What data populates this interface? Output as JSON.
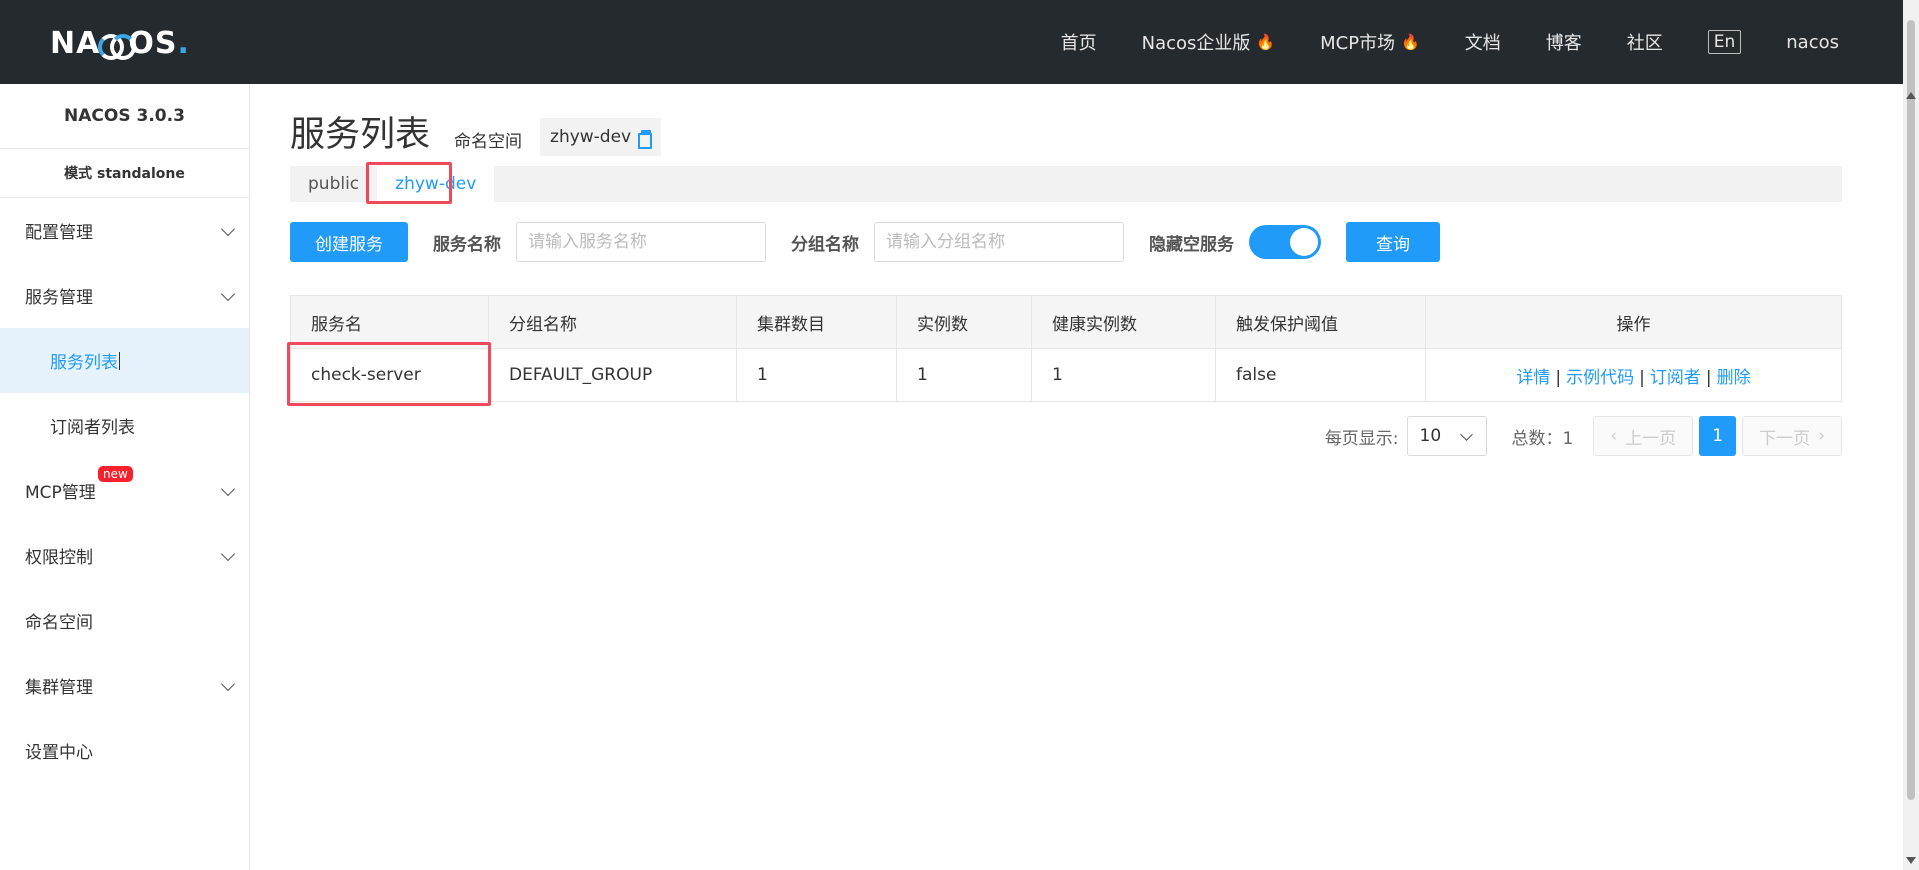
{
  "header": {
    "logo": "NACOS.",
    "nav": [
      {
        "label": "首页",
        "hot": false
      },
      {
        "label": "Nacos企业版",
        "hot": true
      },
      {
        "label": "MCP市场",
        "hot": true
      },
      {
        "label": "文档",
        "hot": false
      },
      {
        "label": "博客",
        "hot": false
      },
      {
        "label": "社区",
        "hot": false
      }
    ],
    "lang": "En",
    "user": "nacos"
  },
  "sidebar": {
    "version": "NACOS 3.0.3",
    "mode": "模式 standalone",
    "items": [
      {
        "label": "配置管理"
      },
      {
        "label": "服务管理"
      },
      {
        "label": "服务列表"
      },
      {
        "label": "订阅者列表"
      },
      {
        "label": "MCP管理",
        "badge": "new"
      },
      {
        "label": "权限控制"
      },
      {
        "label": "命名空间"
      },
      {
        "label": "集群管理"
      },
      {
        "label": "设置中心"
      }
    ]
  },
  "main": {
    "title": "服务列表",
    "namespace_label": "命名空间",
    "namespace_value": "zhyw-dev",
    "ns_tabs": [
      "public",
      "zhyw-dev"
    ],
    "create_button": "创建服务",
    "service_name_label": "服务名称",
    "service_name_placeholder": "请输入服务名称",
    "group_name_label": "分组名称",
    "group_name_placeholder": "请输入分组名称",
    "hide_empty_label": "隐藏空服务",
    "hide_empty_on": true,
    "query_button": "查询",
    "table": {
      "columns": [
        "服务名",
        "分组名称",
        "集群数目",
        "实例数",
        "健康实例数",
        "触发保护阈值",
        "操作"
      ],
      "rows": [
        {
          "service": "check-server",
          "group": "DEFAULT_GROUP",
          "clusters": "1",
          "instances": "1",
          "healthy": "1",
          "threshold": "false"
        }
      ],
      "actions": [
        "详情",
        "示例代码",
        "订阅者",
        "删除"
      ]
    },
    "pagination": {
      "per_page_label": "每页显示:",
      "per_page_value": "10",
      "total": "总数：1",
      "prev": "上一页",
      "current": "1",
      "next": "下一页"
    }
  },
  "colors": {
    "accent": "#209bfa",
    "header_bg": "#252a2f",
    "highlight": "#ef4a5c",
    "hot": "#e23b2e"
  }
}
